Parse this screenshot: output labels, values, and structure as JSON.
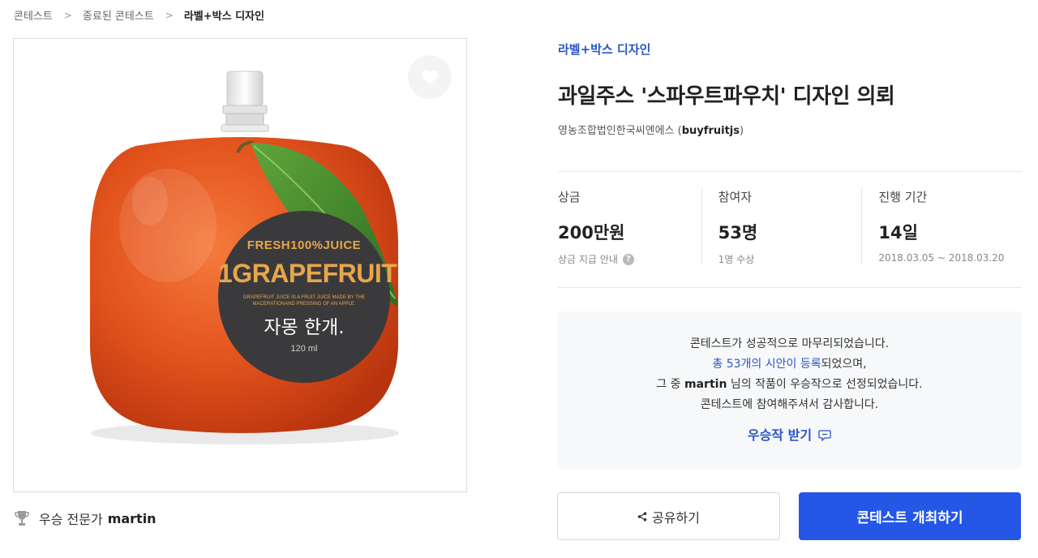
{
  "breadcrumb": {
    "items": [
      "콘테스트",
      "종료된 콘테스트",
      "라벨+박스 디자인"
    ]
  },
  "product_image": {
    "label_top": "FRESH100%JUICE",
    "label_main": "1GRAPEFRUIT",
    "label_desc_line1": "GRAPEFRUIT JUICE IS A FRUIT JUICE MADE BY THE",
    "label_desc_line2": "MACERATIONAND PRESSING OF AN APPLE.",
    "label_korean": "자몽 한개.",
    "label_volume": "120 ml",
    "colors": {
      "fruit": "#e8541c",
      "leaf": "#3e8b2c",
      "label": "#3a3a3c",
      "label_text": "#e8a64a"
    }
  },
  "winner": {
    "prefix": "우승 전문가",
    "name": "martin"
  },
  "contest": {
    "category": "라벨+박스 디자인",
    "title": "과일주스 '스파우트파우치' 디자인 의뢰",
    "host_name": "영농조합법인한국씨엔에스",
    "host_handle_open": "(",
    "host_handle": "buyfruitjs",
    "host_handle_close": ")"
  },
  "stats": [
    {
      "label": "상금",
      "value": "200만원",
      "sub": "상금 지급 안내"
    },
    {
      "label": "참여자",
      "value": "53명",
      "sub": "1명 수상"
    },
    {
      "label": "진행 기간",
      "value": "14일",
      "sub": "2018.03.05 ~ 2018.03.20"
    }
  ],
  "notice": {
    "line1": "콘테스트가 성공적으로 마무리되었습니다.",
    "line2_link": "총 53개의 시안이 등록",
    "line2_rest": "되었으며,",
    "line3_pre": "그 중 ",
    "line3_name": "martin",
    "line3_post": " 님의 작품이 우승작으로 선정되었습니다.",
    "line4": "콘테스트에 참여해주셔서 감사합니다.",
    "action": "우승작 받기"
  },
  "buttons": {
    "share": "공유하기",
    "host": "콘테스트 개최하기"
  },
  "colors": {
    "accent": "#2457e6",
    "link": "#2a56c6"
  }
}
